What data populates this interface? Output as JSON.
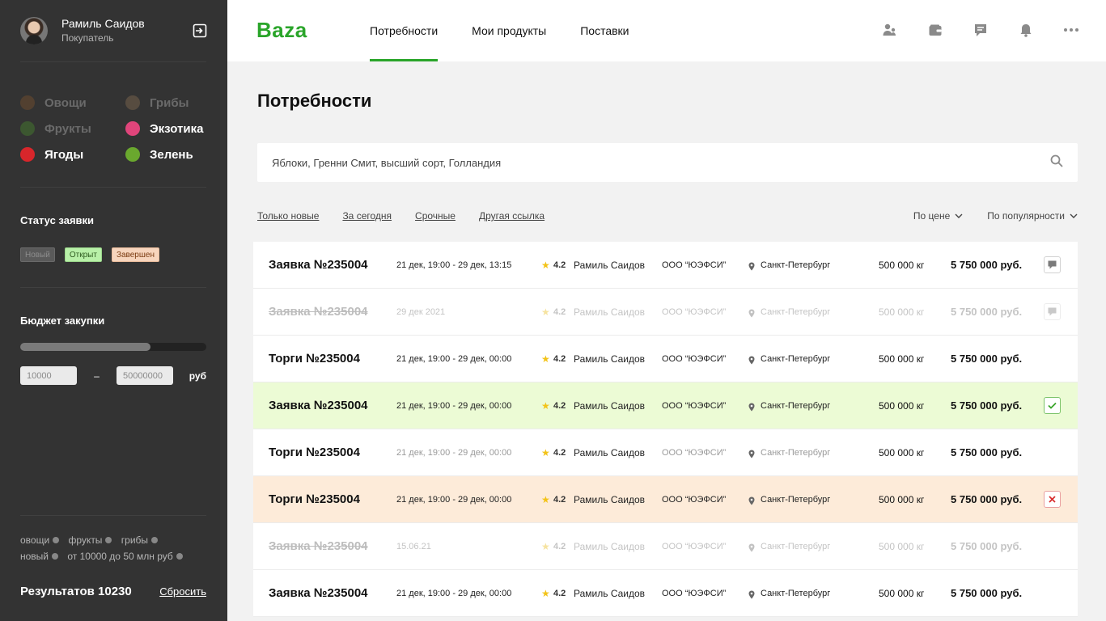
{
  "user": {
    "name": "Рамиль Саидов",
    "role": "Покупатель"
  },
  "categories": [
    {
      "label": "Овощи",
      "color": "#8b5a2b",
      "active": false
    },
    {
      "label": "Грибы",
      "color": "#9a7a5a",
      "active": false
    },
    {
      "label": "Фрукты",
      "color": "#4c9a2a",
      "active": false
    },
    {
      "label": "Экзотика",
      "color": "#e0457b",
      "active": true
    },
    {
      "label": "Ягоды",
      "color": "#d8262b",
      "active": true
    },
    {
      "label": "Зелень",
      "color": "#6aa82e",
      "active": true
    }
  ],
  "status": {
    "title": "Статус заявки",
    "chips": [
      "Новый",
      "Открыт",
      "Завершен"
    ]
  },
  "budget": {
    "title": "Бюджет закупки",
    "fill_fraction": 0.7,
    "min": "10000",
    "max": "50000000",
    "dash": "–",
    "unit": "руб"
  },
  "summary": {
    "tags": [
      "овощи",
      "фрукты",
      "грибы",
      "новый",
      "от 10000 до 50 млн руб"
    ],
    "results": "Результатов 10230",
    "reset": "Сбросить"
  },
  "header": {
    "logo": "Baza",
    "nav": [
      "Потребности",
      "Мои продукты",
      "Поставки"
    ],
    "active_nav": 0,
    "icons": [
      "users-icon",
      "wallet-icon",
      "chat-icon",
      "bell-icon",
      "more-icon"
    ]
  },
  "main": {
    "title": "Потребности",
    "search_value": "Яблоки, Гренни Смит, высший сорт, Голландия",
    "quick_filters": [
      "Только новые",
      "За сегодня",
      "Срочные",
      "Другая ссылка"
    ],
    "sorts": [
      "По цене",
      "По популярности"
    ]
  },
  "rows": [
    {
      "title": "Заявка №235004",
      "date": "21 дек, 19:00 - 29 дек, 13:15",
      "rating": "4.2",
      "name": "Рамиль Саидов",
      "company": "ООО “ЮЭФСИ”",
      "city": "Санкт-Петербург",
      "weight": "500 000 кг",
      "price": "5 750 000 руб.",
      "style": "normal",
      "action": "chat"
    },
    {
      "title": "Заявка №235004",
      "date": "29 дек 2021",
      "rating": "4.2",
      "name": "Рамиль Саидов",
      "company": "ООО “ЮЭФСИ”",
      "city": "Санкт-Петербург",
      "weight": "500 000 кг",
      "price": "5 750 000 руб.",
      "style": "faded",
      "action": "chat"
    },
    {
      "title": "Торги №235004",
      "date": "21 дек, 19:00 - 29 дек, 00:00",
      "rating": "4.2",
      "name": "Рамиль Саидов",
      "company": "ООО “ЮЭФСИ”",
      "city": "Санкт-Петербург",
      "weight": "500 000 кг",
      "price": "5 750 000 руб.",
      "style": "normal",
      "action": "none"
    },
    {
      "title": "Заявка №235004",
      "date": "21 дек, 19:00 - 29 дек, 00:00",
      "rating": "4.2",
      "name": "Рамиль Саидов",
      "company": "ООО “ЮЭФСИ”",
      "city": "Санкт-Петербург",
      "weight": "500 000 кг",
      "price": "5 750 000 руб.",
      "style": "green",
      "action": "check"
    },
    {
      "title": "Торги №235004",
      "date": "21 дек, 19:00 - 29 дек, 00:00",
      "rating": "4.2",
      "name": "Рамиль Саидов",
      "company": "ООО “ЮЭФСИ”",
      "city": "Санкт-Петербург",
      "weight": "500 000 кг",
      "price": "5 750 000 руб.",
      "style": "semi",
      "action": "none"
    },
    {
      "title": "Торги №235004",
      "date": "21 дек, 19:00 - 29 дек, 00:00",
      "rating": "4.2",
      "name": "Рамиль Саидов",
      "company": "ООО “ЮЭФСИ”",
      "city": "Санкт-Петербург",
      "weight": "500 000 кг",
      "price": "5 750 000 руб.",
      "style": "orange",
      "action": "x"
    },
    {
      "title": "Заявка №235004",
      "date": "15.06.21",
      "rating": "4.2",
      "name": "Рамиль Саидов",
      "company": "ООО “ЮЭФСИ”",
      "city": "Санкт-Петербург",
      "weight": "500 000 кг",
      "price": "5 750 000 руб.",
      "style": "faded",
      "action": "none"
    },
    {
      "title": "Заявка №235004",
      "date": "21 дек, 19:00 - 29 дек, 00:00",
      "rating": "4.2",
      "name": "Рамиль Саидов",
      "company": "ООО “ЮЭФСИ”",
      "city": "Санкт-Петербург",
      "weight": "500 000 кг",
      "price": "5 750 000 руб.",
      "style": "normal",
      "action": "none"
    }
  ],
  "colors": {
    "accent": "#2aa52a",
    "sidebar": "#333333",
    "row_green": "#ecfbd5",
    "row_orange": "#fdebd9"
  }
}
